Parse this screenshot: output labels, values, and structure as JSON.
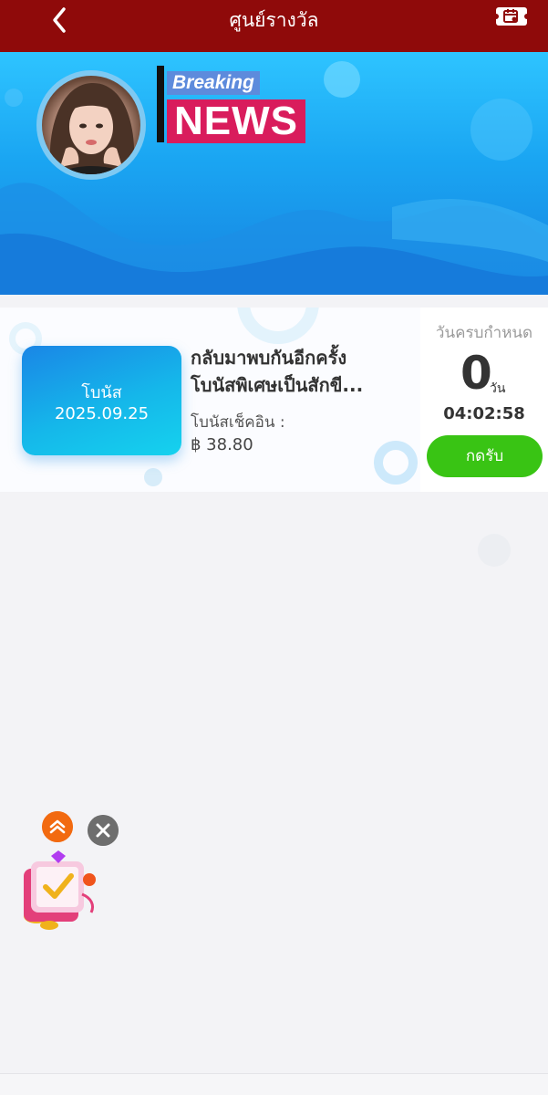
{
  "header": {
    "title": "ศูนย์รางวัล",
    "back_icon": "chevron-left-icon",
    "calendar_icon": "calendar-icon",
    "bg_color": "#8f0a0a"
  },
  "banner": {
    "breaking_text": "Breaking",
    "news_text": "NEWS",
    "avatar_icon": "profile-avatar"
  },
  "reward": {
    "tile_label": "โบนัส",
    "tile_date": "2025.09.25",
    "title_line1": "กลับมาพบกันอีกครั้ง",
    "title_line2": "โบนัสพิเศษเป็นสักขี...",
    "sub_label": "โบนัสเช็คอิน :",
    "amount": "฿ 38.80",
    "deadline_label": "วันครบกำหนด",
    "days_left": "0",
    "days_unit": "วัน",
    "time_left": "04:02:58",
    "claim_label": "กดรับ",
    "claim_color": "#39c414"
  },
  "floating": {
    "up_icon": "double-chevron-up-icon",
    "close_icon": "close-icon",
    "gift_icon": "checkin-gift-icon"
  }
}
